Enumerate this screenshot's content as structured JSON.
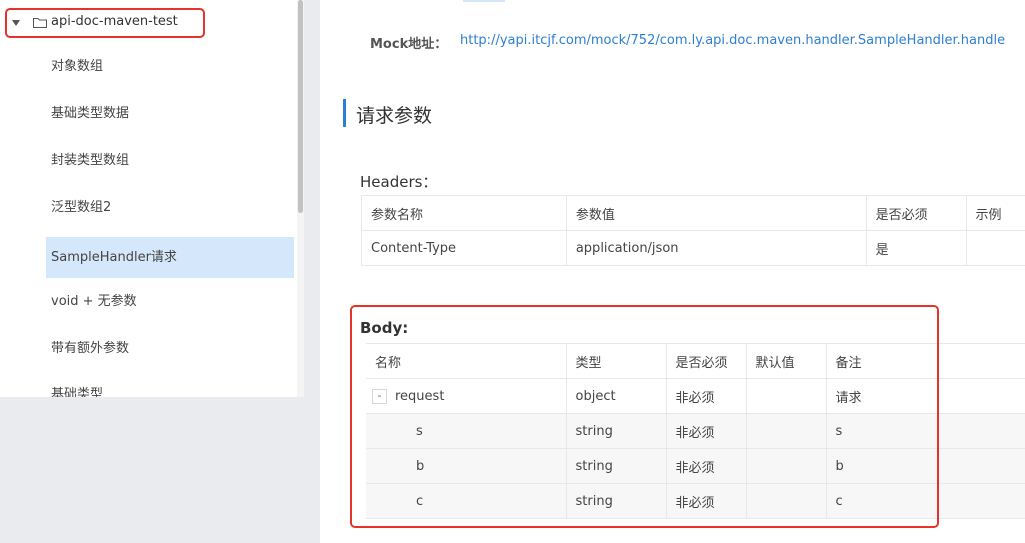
{
  "sidebar": {
    "root_label": "api-doc-maven-test",
    "items": [
      {
        "label": "对象数组"
      },
      {
        "label": "基础类型数据"
      },
      {
        "label": "封装类型数组"
      },
      {
        "label": "泛型数组2"
      },
      {
        "label": "SampleHandler请求"
      },
      {
        "label": "void + 无参数"
      },
      {
        "label": "带有额外参数"
      },
      {
        "label": "基础类型"
      }
    ],
    "active_index": 4
  },
  "mock": {
    "label": "Mock地址：",
    "url": "http://yapi.itcjf.com/mock/752/com.ly.api.doc.maven.handler.SampleHandler.handle"
  },
  "request_params": {
    "title": "请求参数",
    "headers_title": "Headers：",
    "headers_columns": [
      "参数名称",
      "参数值",
      "是否必须",
      "示例"
    ],
    "headers_rows": [
      [
        "Content-Type",
        "application/json",
        "是",
        ""
      ]
    ],
    "body_title": "Body:",
    "body_columns": [
      "名称",
      "类型",
      "是否必须",
      "默认值",
      "备注"
    ],
    "body_rows": [
      {
        "name": "request",
        "expand_symbol": "-",
        "type": "object",
        "required": "非必须",
        "default": "",
        "note": "请求"
      },
      {
        "name": "s",
        "type": "string",
        "required": "非必须",
        "default": "",
        "note": "s"
      },
      {
        "name": "b",
        "type": "string",
        "required": "非必须",
        "default": "",
        "note": "b"
      },
      {
        "name": "c",
        "type": "string",
        "required": "非必须",
        "default": "",
        "note": "c"
      }
    ]
  },
  "colors": {
    "accent": "#2d7fd3",
    "highlight_border": "#e5322b",
    "active_item_bg": "#d5e8fb"
  }
}
